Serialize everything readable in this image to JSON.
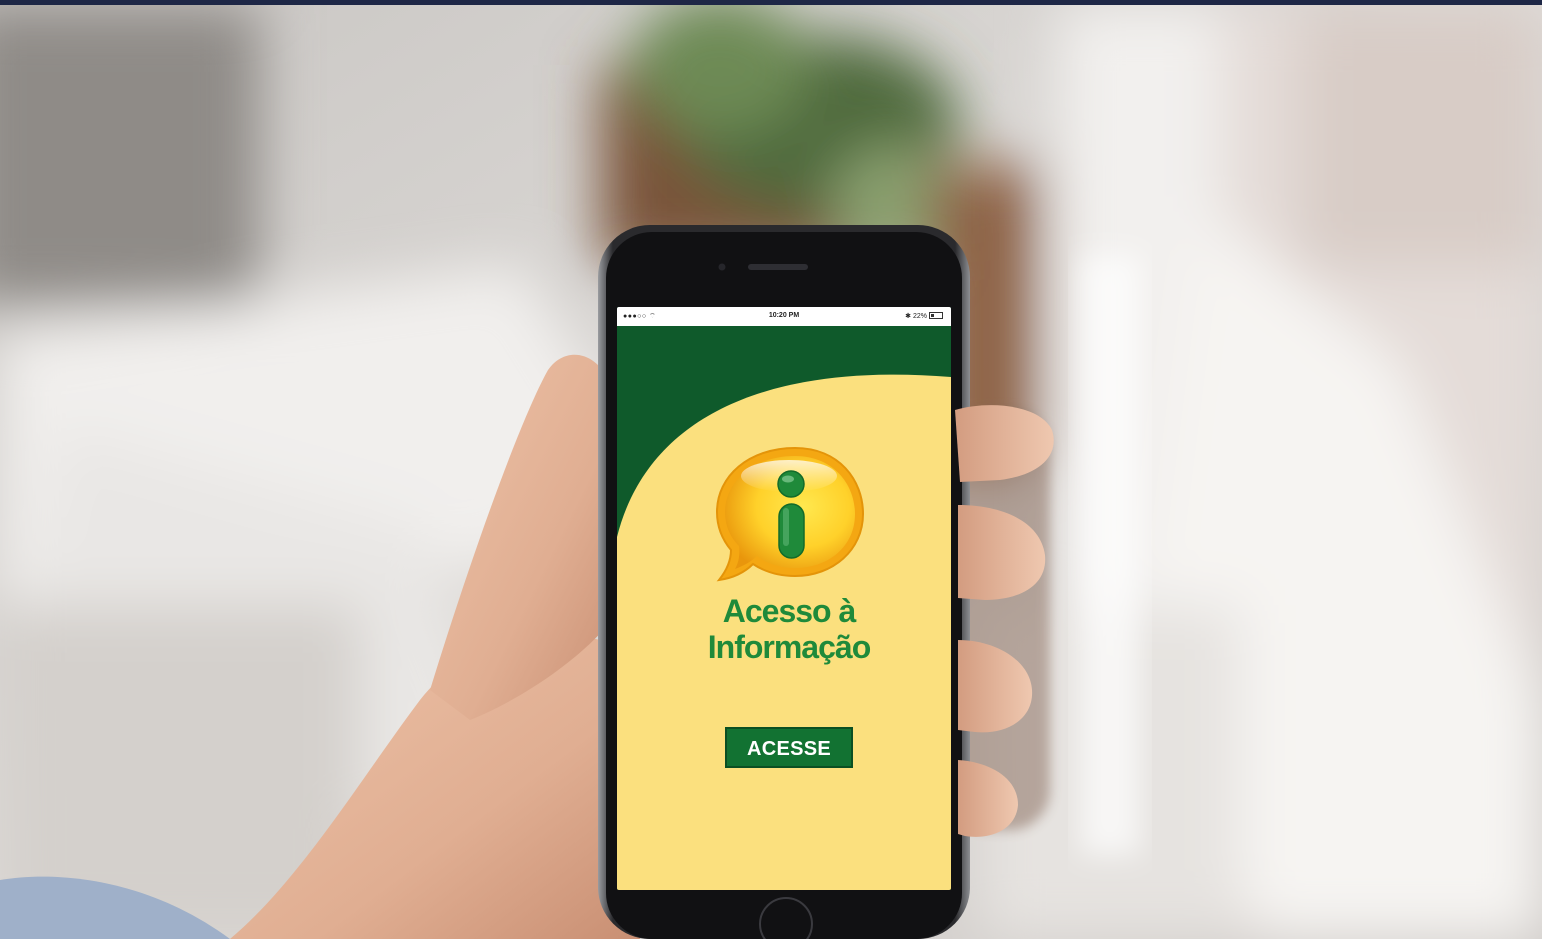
{
  "photo": {
    "subject": "hand holding smartphone",
    "background_colors": {
      "wall": "#dcdad8",
      "window": "#eae6e4",
      "plant": "#5d7a4a",
      "pot": "#8a5a3a",
      "skin": "#e3b49a",
      "phone_body": "#2b2b2e"
    }
  },
  "status_bar": {
    "left": "●●●○○ ⌔",
    "time": "10:20 PM",
    "right": "✱ 22%"
  },
  "app": {
    "logo_glyph": "i",
    "title_line1": "Acesso à",
    "title_line2": "Informação",
    "button_label": "ACESSE"
  },
  "colors": {
    "dark_green": "#0f5a2b",
    "title_green": "#1f8a3a",
    "yellow": "#fbe07e",
    "logo_orange": "#f0a70f",
    "logo_yellow": "#ffd83a",
    "button_green": "#127232"
  }
}
